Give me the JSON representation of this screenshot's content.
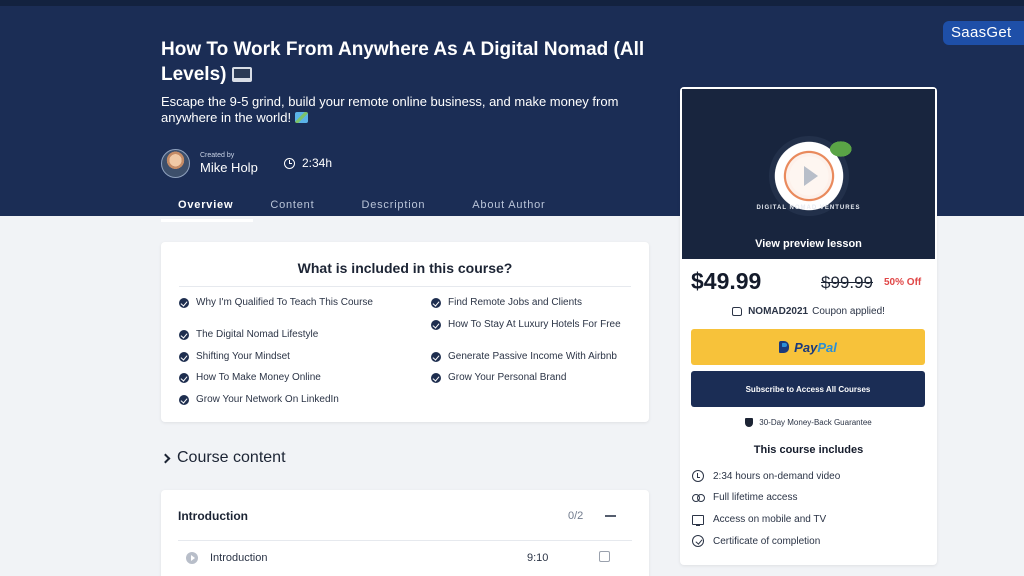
{
  "brand": "SaasGet",
  "course": {
    "title": "How To Work From Anywhere As A Digital Nomad (All Levels)",
    "subtitle": "Escape the 9-5 grind, build your remote online business, and make money from anywhere in the world!",
    "created_by_label": "Created by",
    "author": "Mike Holp",
    "duration": "2:34h"
  },
  "tabs": [
    "Overview",
    "Content",
    "Description",
    "About Author"
  ],
  "included": {
    "title": "What is included in this course?",
    "left": [
      "Why I'm Qualified To Teach This Course",
      "The Digital Nomad Lifestyle",
      "Shifting Your Mindset",
      "How To Make Money Online",
      "Grow Your Network On LinkedIn"
    ],
    "right": [
      "Find Remote Jobs and Clients",
      "How To Stay At Luxury Hotels For Free",
      "Generate Passive Income With Airbnb",
      "Grow Your Personal Brand"
    ]
  },
  "course_content": {
    "heading": "Course content",
    "section_title": "Introduction",
    "section_count": "0/2",
    "lesson_title": "Introduction",
    "lesson_time": "9:10"
  },
  "sidebar": {
    "badge_text": "DIGITAL NOMAD VENTURES",
    "preview_label": "View preview lesson",
    "price": "$49.99",
    "old_price": "$99.99",
    "discount": "50% Off",
    "coupon_code": "NOMAD2021",
    "coupon_suffix": "Coupon applied!",
    "paypal_pay": "Pay",
    "paypal_pal": "Pal",
    "subscribe_label": "Subscribe to Access All Courses",
    "guarantee": "30-Day Money-Back Guarantee",
    "includes_title": "This course includes",
    "includes": [
      {
        "icon": "clock-icon",
        "text": "2:34 hours on-demand video"
      },
      {
        "icon": "infinity-icon",
        "text": "Full lifetime access"
      },
      {
        "icon": "tv-icon",
        "text": "Access on mobile and TV"
      },
      {
        "icon": "certificate-icon",
        "text": "Certificate of completion"
      }
    ]
  },
  "colors": {
    "hero": "#1b2d55",
    "paypal": "#f7c23a",
    "discount": "#e04646"
  }
}
